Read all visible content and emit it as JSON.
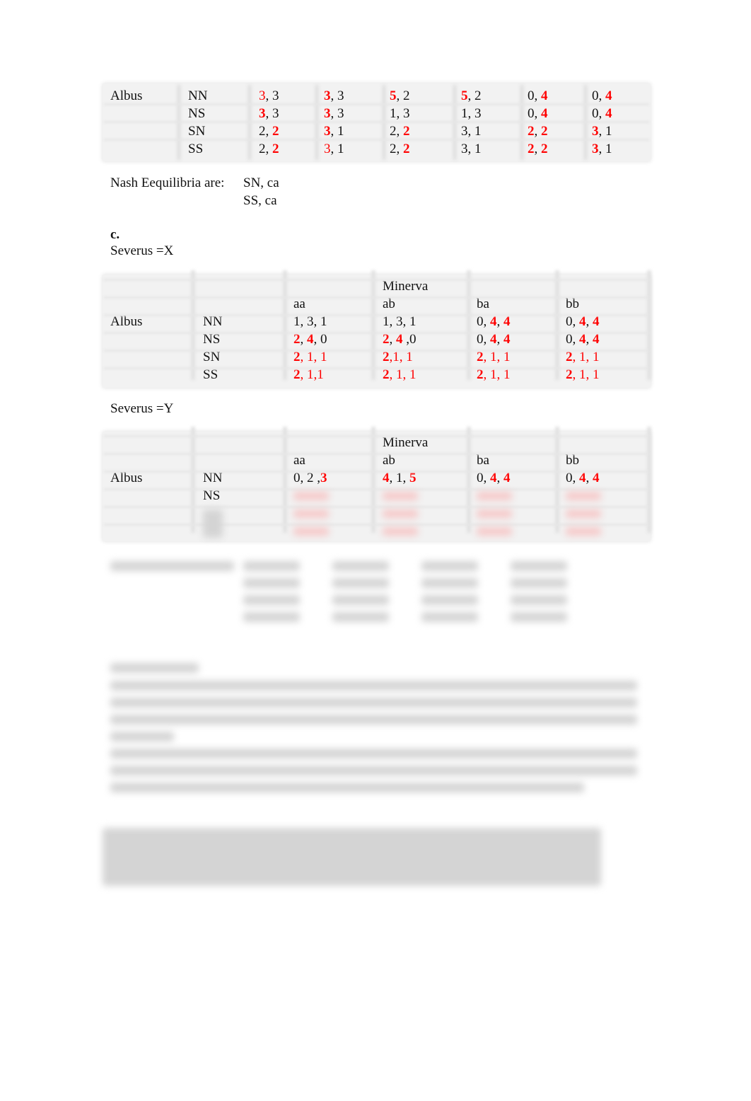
{
  "colors": {
    "highlight": "#ff0000",
    "table_bg": "#f2f2f2"
  },
  "table1": {
    "row_player": "Albus",
    "rows": [
      {
        "strategy": "NN",
        "cells": [
          [
            {
              "t": "3",
              "r": 1
            },
            {
              "t": ", 3"
            }
          ],
          [
            {
              "t": "3",
              "r": 1,
              "b": 1
            },
            {
              "t": ", 3"
            }
          ],
          [
            {
              "t": "5",
              "r": 1,
              "b": 1
            },
            {
              "t": ", 2"
            }
          ],
          [
            {
              "t": "5",
              "r": 1,
              "b": 1
            },
            {
              "t": ", 2"
            }
          ],
          [
            {
              "t": "0, "
            },
            {
              "t": "4",
              "r": 1,
              "b": 1
            }
          ],
          [
            {
              "t": "0, "
            },
            {
              "t": "4",
              "r": 1,
              "b": 1
            }
          ]
        ]
      },
      {
        "strategy": "NS",
        "cells": [
          [
            {
              "t": "3",
              "r": 1,
              "b": 1
            },
            {
              "t": ", 3"
            }
          ],
          [
            {
              "t": "3",
              "r": 1,
              "b": 1
            },
            {
              "t": ", 3"
            }
          ],
          [
            {
              "t": "1, 3"
            }
          ],
          [
            {
              "t": "1, 3"
            }
          ],
          [
            {
              "t": "0, "
            },
            {
              "t": "4",
              "r": 1,
              "b": 1
            }
          ],
          [
            {
              "t": "0, "
            },
            {
              "t": "4",
              "r": 1,
              "b": 1
            }
          ]
        ]
      },
      {
        "strategy": "SN",
        "cells": [
          [
            {
              "t": "2, "
            },
            {
              "t": "2",
              "r": 1,
              "b": 1
            }
          ],
          [
            {
              "t": "3",
              "r": 1,
              "b": 1
            },
            {
              "t": ", 1"
            }
          ],
          [
            {
              "t": "2, "
            },
            {
              "t": "2",
              "r": 1,
              "b": 1
            }
          ],
          [
            {
              "t": "3, 1"
            }
          ],
          [
            {
              "t": "2",
              "r": 1,
              "b": 1
            },
            {
              "t": ", "
            },
            {
              "t": "2",
              "r": 1,
              "b": 1
            }
          ],
          [
            {
              "t": "3",
              "r": 1,
              "b": 1
            },
            {
              "t": ", 1"
            }
          ]
        ]
      },
      {
        "strategy": "SS",
        "cells": [
          [
            {
              "t": "2, "
            },
            {
              "t": "2",
              "r": 1,
              "b": 1
            }
          ],
          [
            {
              "t": "3",
              "r": 1
            },
            {
              "t": ", 1"
            }
          ],
          [
            {
              "t": "2, "
            },
            {
              "t": "2",
              "r": 1,
              "b": 1
            }
          ],
          [
            {
              "t": "3, 1"
            }
          ],
          [
            {
              "t": "2",
              "r": 1,
              "b": 1
            },
            {
              "t": ", "
            },
            {
              "t": "2",
              "r": 1,
              "b": 1
            }
          ],
          [
            {
              "t": "3",
              "r": 1,
              "b": 1
            },
            {
              "t": ", 1"
            }
          ]
        ]
      }
    ]
  },
  "nash": {
    "label": "Nash Eequilibria are:",
    "items": [
      "SN, ca",
      "SS, ca"
    ]
  },
  "section_c": {
    "label": "c.",
    "severus_x": "Severus =X",
    "severus_y": "Severus =Y"
  },
  "table2": {
    "col_player": "Minerva",
    "row_player": "Albus",
    "columns": [
      "aa",
      "ab",
      "ba",
      "bb"
    ],
    "rows": [
      {
        "strategy": "NN",
        "cells": [
          [
            {
              "t": "1, 3, 1"
            }
          ],
          [
            {
              "t": "1, 3, 1"
            }
          ],
          [
            {
              "t": "0, "
            },
            {
              "t": "4",
              "r": 1,
              "b": 1
            },
            {
              "t": ", "
            },
            {
              "t": "4",
              "r": 1,
              "b": 1
            }
          ],
          [
            {
              "t": "0, "
            },
            {
              "t": "4",
              "r": 1,
              "b": 1
            },
            {
              "t": ", "
            },
            {
              "t": "4",
              "r": 1,
              "b": 1
            }
          ]
        ]
      },
      {
        "strategy": "NS",
        "cells": [
          [
            {
              "t": "2",
              "r": 1,
              "b": 1
            },
            {
              "t": ", "
            },
            {
              "t": "4",
              "r": 1,
              "b": 1
            },
            {
              "t": ", 0"
            }
          ],
          [
            {
              "t": "2",
              "r": 1,
              "b": 1
            },
            {
              "t": ", "
            },
            {
              "t": "4",
              "r": 1,
              "b": 1
            },
            {
              "t": " ,0"
            }
          ],
          [
            {
              "t": "0, "
            },
            {
              "t": "4",
              "r": 1,
              "b": 1
            },
            {
              "t": ", "
            },
            {
              "t": "4",
              "r": 1,
              "b": 1
            }
          ],
          [
            {
              "t": "0, "
            },
            {
              "t": "4",
              "r": 1,
              "b": 1
            },
            {
              "t": ", "
            },
            {
              "t": "4",
              "r": 1,
              "b": 1
            }
          ]
        ]
      },
      {
        "strategy": "SN",
        "cells": [
          [
            {
              "t": "2",
              "r": 1,
              "b": 1
            },
            {
              "t": ", 1, 1",
              "r": 1
            }
          ],
          [
            {
              "t": "2",
              "r": 1,
              "b": 1
            },
            {
              "t": ",1, 1",
              "r": 1
            }
          ],
          [
            {
              "t": "2",
              "r": 1,
              "b": 1
            },
            {
              "t": ", 1, 1",
              "r": 1
            }
          ],
          [
            {
              "t": "2",
              "r": 1,
              "b": 1
            },
            {
              "t": ", 1, 1",
              "r": 1
            }
          ]
        ]
      },
      {
        "strategy": "SS",
        "cells": [
          [
            {
              "t": "2",
              "r": 1,
              "b": 1
            },
            {
              "t": ", 1,1",
              "r": 1
            }
          ],
          [
            {
              "t": "2",
              "r": 1,
              "b": 1
            },
            {
              "t": ", 1, 1",
              "r": 1
            }
          ],
          [
            {
              "t": "2",
              "r": 1,
              "b": 1
            },
            {
              "t": ", 1, 1",
              "r": 1
            }
          ],
          [
            {
              "t": "2",
              "r": 1,
              "b": 1
            },
            {
              "t": ", 1, 1",
              "r": 1
            }
          ]
        ]
      }
    ]
  },
  "table3": {
    "col_player": "Minerva",
    "row_player": "Albus",
    "columns": [
      "aa",
      "ab",
      "ba",
      "bb"
    ],
    "rows": [
      {
        "strategy": "NN",
        "cells": [
          [
            {
              "t": "0, 2 ,"
            },
            {
              "t": "3",
              "r": 1,
              "b": 1
            }
          ],
          [
            {
              "t": "4",
              "r": 1,
              "b": 1
            },
            {
              "t": ", 1, "
            },
            {
              "t": "5",
              "r": 1,
              "b": 1
            }
          ],
          [
            {
              "t": "0, "
            },
            {
              "t": "4",
              "r": 1,
              "b": 1
            },
            {
              "t": ", "
            },
            {
              "t": "4",
              "r": 1,
              "b": 1
            }
          ],
          [
            {
              "t": "0, "
            },
            {
              "t": "4",
              "r": 1,
              "b": 1
            },
            {
              "t": ", "
            },
            {
              "t": "4",
              "r": 1,
              "b": 1
            }
          ]
        ]
      },
      {
        "strategy": "NS",
        "cells": []
      }
    ]
  }
}
